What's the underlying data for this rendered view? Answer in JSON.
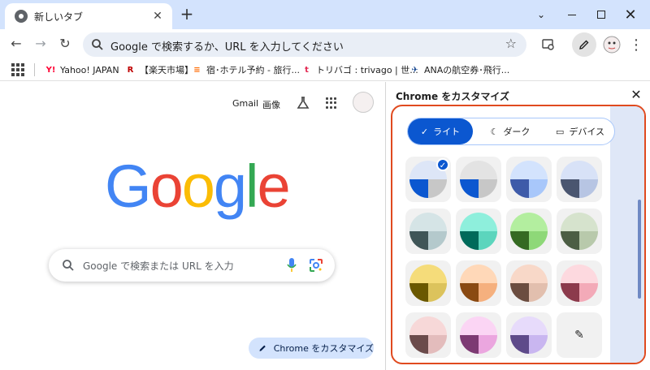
{
  "window": {
    "tab_title": "新しいタブ",
    "new_tab": "+",
    "close_tab": "✕",
    "chevron": "⌄",
    "close_window": "✕"
  },
  "toolbar": {
    "back": "←",
    "forward": "→",
    "reload": "↻",
    "omnibox_text": "Google で検索するか、URL を入力してください",
    "star": "☆",
    "menu": "⋮"
  },
  "bookmarks": [
    {
      "label": "Yahoo! JAPAN",
      "icon": "Y!",
      "color": "#ff0033"
    },
    {
      "label": "【楽天市場】",
      "icon": "R",
      "color": "#bf0000"
    },
    {
      "label": "宿･ホテル予約 - 旅行...",
      "icon": "≡",
      "color": "#ff6a00"
    },
    {
      "label": "トリバゴ : trivago | 世...",
      "icon": "t",
      "color": "#e32851"
    },
    {
      "label": "ANAの航空券･飛行...",
      "icon": "✈",
      "color": "#13448f"
    }
  ],
  "ntp": {
    "gmail": "Gmail",
    "images": "画像",
    "logo": [
      "G",
      "o",
      "o",
      "g",
      "l",
      "e"
    ],
    "logo_colors": [
      "#4285f4",
      "#ea4335",
      "#fbbc05",
      "#4285f4",
      "#34a853",
      "#ea4335"
    ],
    "search_placeholder": "Google で検索または URL を入力",
    "customize_label": "Chrome をカスタマイズ"
  },
  "panel": {
    "title": "Chrome をカスタマイズ",
    "close": "✕",
    "modes": {
      "light": "ライト",
      "dark": "ダーク",
      "device": "デバイス"
    },
    "selected_mode": "light",
    "themes": [
      {
        "name": "default-blue",
        "top": "#dde6f7",
        "bl": "#0b57d0",
        "br": "#c7c7c7",
        "selected": true
      },
      {
        "name": "grey",
        "top": "#e3e3e3",
        "bl": "#0b57d0",
        "br": "#c7c7c7"
      },
      {
        "name": "blue",
        "top": "#d3e3fd",
        "bl": "#3e5ba9",
        "br": "#a8c7fa"
      },
      {
        "name": "slate-blue",
        "top": "#d8e2f7",
        "bl": "#4a5670",
        "br": "#b7c5e3"
      },
      {
        "name": "teal-grey",
        "top": "#d5e4e6",
        "bl": "#3f5557",
        "br": "#b4c9cc"
      },
      {
        "name": "aqua",
        "top": "#8eefdc",
        "bl": "#006a5a",
        "br": "#5cd5bd"
      },
      {
        "name": "green",
        "top": "#b3ee9f",
        "bl": "#356a22",
        "br": "#8ed878"
      },
      {
        "name": "sage",
        "top": "#d6e3cd",
        "bl": "#4c5e44",
        "br": "#b8c9ab"
      },
      {
        "name": "yellow",
        "top": "#f5dc7a",
        "bl": "#6a5800",
        "br": "#dcc35c"
      },
      {
        "name": "orange",
        "top": "#ffd8b8",
        "bl": "#8a4a12",
        "br": "#f5b07e"
      },
      {
        "name": "peach",
        "top": "#f8d8c8",
        "bl": "#6b4d40",
        "br": "#e2bfae"
      },
      {
        "name": "pink",
        "top": "#fdd9df",
        "bl": "#8c3a4c",
        "br": "#f3aab8"
      },
      {
        "name": "rose",
        "top": "#f7d8d8",
        "bl": "#6b4b4b",
        "br": "#e3bcbc"
      },
      {
        "name": "magenta",
        "top": "#fbd5f4",
        "bl": "#7d3a73",
        "br": "#eba6df"
      },
      {
        "name": "lavender",
        "top": "#e7dbfb",
        "bl": "#5e4a8a",
        "br": "#c9b6f0"
      },
      {
        "name": "custom-color",
        "picker": true
      }
    ]
  }
}
